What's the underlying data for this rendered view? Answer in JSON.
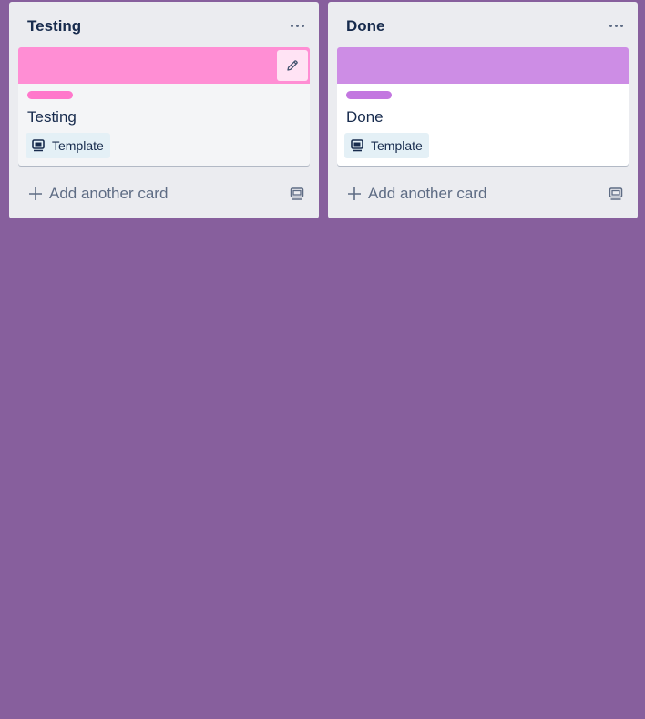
{
  "lists": [
    {
      "title": "Testing",
      "menu_icon": "more-horizontal-icon",
      "card": {
        "cover_color": "#ff8ed4",
        "label_color": "#ff78cb",
        "title": "Testing",
        "badge_label": "Template",
        "badge_icon": "card-template-icon",
        "edit_icon": "pencil-icon"
      },
      "add_card_label": "Add another card",
      "add_icon": "plus-icon",
      "template_icon": "create-from-template-icon"
    },
    {
      "title": "Done",
      "menu_icon": "more-horizontal-icon",
      "card": {
        "cover_color": "#cd8de5",
        "label_color": "#c377e0",
        "title": "Done",
        "badge_label": "Template",
        "badge_icon": "card-template-icon"
      },
      "add_card_label": "Add another card",
      "add_icon": "plus-icon",
      "template_icon": "create-from-template-icon"
    }
  ],
  "colors": {
    "board_background": "#875f9d",
    "list_background": "#ebecf0",
    "text_primary": "#172b4d",
    "text_secondary": "#5e6c84",
    "badge_background": "#e4f0f6"
  }
}
